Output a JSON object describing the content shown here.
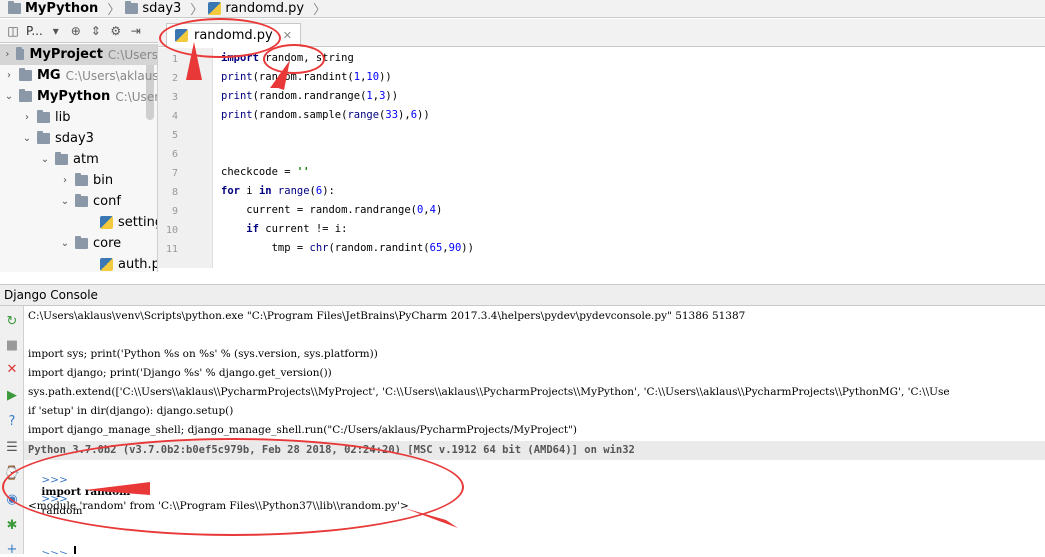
{
  "breadcrumb": [
    {
      "label": "MyPython",
      "icon": "folder-icon"
    },
    {
      "label": "sday3",
      "icon": "folder-icon"
    },
    {
      "label": "randomd.py",
      "icon": "python-file-icon"
    }
  ],
  "project_toolbar": {
    "view_label": "P..."
  },
  "tree": [
    {
      "label": "MyProject",
      "path": "C:\\Users",
      "depth": 0,
      "expanded": false,
      "bold": true,
      "selected": true
    },
    {
      "label": "MG",
      "path": "C:\\Users\\aklaus",
      "depth": 0,
      "expanded": false,
      "bold": true
    },
    {
      "label": "MyPython",
      "path": "C:\\Users",
      "depth": 0,
      "expanded": true,
      "bold": true
    },
    {
      "label": "lib",
      "depth": 1,
      "expanded": false
    },
    {
      "label": "sday3",
      "depth": 1,
      "expanded": true
    },
    {
      "label": "atm",
      "depth": 2,
      "expanded": true
    },
    {
      "label": "bin",
      "depth": 3,
      "expanded": false
    },
    {
      "label": "conf",
      "depth": 3,
      "expanded": true
    },
    {
      "label": "setting",
      "depth": 4,
      "file": true
    },
    {
      "label": "core",
      "depth": 3,
      "expanded": true
    },
    {
      "label": "auth.p",
      "depth": 4,
      "file": true
    }
  ],
  "editor": {
    "tab_label": "randomd.py",
    "line_numbers": [
      "1",
      "2",
      "3",
      "4",
      "5",
      "6",
      "7",
      "8",
      "9",
      "10",
      "11"
    ]
  },
  "console": {
    "title": "Django Console",
    "lines": [
      "C:\\Users\\aklaus\\venv\\Scripts\\python.exe \"C:\\Program Files\\JetBrains\\PyCharm 2017.3.4\\helpers\\pydev\\pydevconsole.py\" 51386 51387",
      "",
      "import sys; print('Python %s on %s' % (sys.version, sys.platform))",
      "import django; print('Django %s' % django.get_version())",
      "sys.path.extend(['C:\\\\Users\\\\aklaus\\\\PycharmProjects\\\\MyProject', 'C:\\\\Users\\\\aklaus\\\\PycharmProjects\\\\MyPython', 'C:\\\\Users\\\\aklaus\\\\PycharmProjects\\\\PythonMG', 'C:\\\\Use",
      "if 'setup' in dir(django): django.setup()",
      "import django_manage_shell; django_manage_shell.run(\"C:/Users/aklaus/PycharmProjects/MyProject\")"
    ],
    "banner": "Python 3.7.0b2 (v3.7.0b2:b0ef5c979b, Feb 28 2018, 02:24:20) [MSC v.1912 64 bit (AMD64)] on win32",
    "prompt": ">>>",
    "input1": "import random",
    "input2": "random",
    "output": "<module 'random' from 'C:\\\\Program Files\\\\Python37\\\\lib\\\\random.py'>"
  },
  "colors": {
    "annotation": "#e83838",
    "keyword": "#000080",
    "number": "#0000ff"
  }
}
